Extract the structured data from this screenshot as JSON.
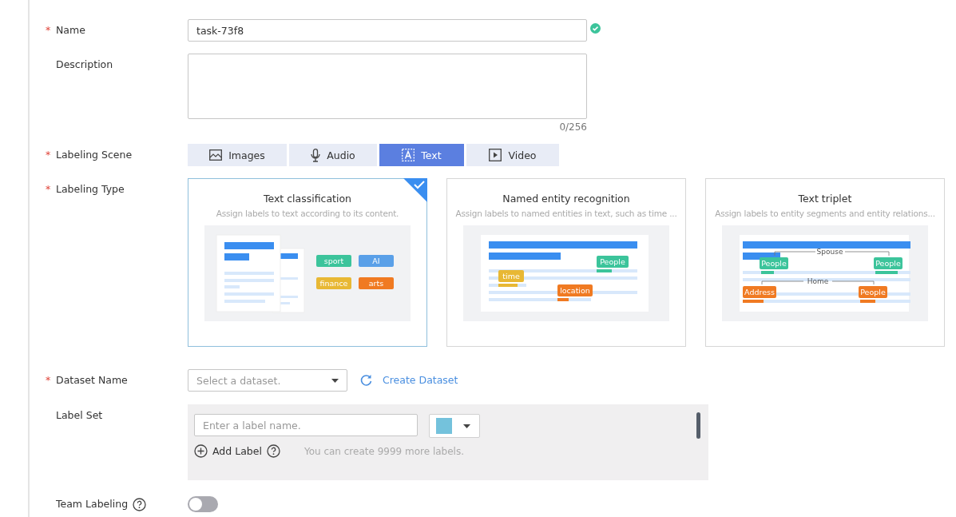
{
  "name_field": {
    "label": "Name",
    "required_mark": "*",
    "value": "task-73f8",
    "valid": true
  },
  "description_field": {
    "label": "Description",
    "counter": "0/256"
  },
  "labeling_scene": {
    "label": "Labeling Scene",
    "required_mark": "*",
    "tabs": [
      {
        "label": "Images",
        "kind": "image",
        "selected": false
      },
      {
        "label": "Audio",
        "kind": "audio",
        "selected": false
      },
      {
        "label": "Text",
        "kind": "text",
        "selected": true
      },
      {
        "label": "Video",
        "kind": "video",
        "selected": false
      }
    ]
  },
  "labeling_type": {
    "label": "Labeling Type",
    "required_mark": "*",
    "cards": [
      {
        "kind": "classification",
        "title": "Text classification",
        "description": "Assign labels to text according to its content.",
        "selected": true,
        "tags": [
          {
            "text": "sport",
            "color": "#3cc49b"
          },
          {
            "text": "AI",
            "color": "#5aa0e8"
          },
          {
            "text": "finance",
            "color": "#e8b834"
          },
          {
            "text": "arts",
            "color": "#f07a22"
          }
        ]
      },
      {
        "kind": "ner",
        "title": "Named entity recognition",
        "description": "Assign labels to named entities in text, such as time ...",
        "selected": false,
        "tags": [
          {
            "text": "People",
            "color": "#3cc49b"
          },
          {
            "text": "time",
            "color": "#e8b834"
          },
          {
            "text": "location",
            "color": "#f07a22"
          }
        ]
      },
      {
        "kind": "triplet",
        "title": "Text triplet",
        "description": "Assign labels to entity segments and entity relations...",
        "selected": false,
        "tags": [
          {
            "text": "People",
            "color": "#3cc49b"
          },
          {
            "text": "People",
            "color": "#3cc49b"
          },
          {
            "text": "Address",
            "color": "#f07a22"
          },
          {
            "text": "People",
            "color": "#f07a22"
          }
        ],
        "relations": [
          "Spouse",
          "Home"
        ]
      }
    ]
  },
  "dataset": {
    "label": "Dataset Name",
    "required_mark": "*",
    "placeholder": "Select a dataset.",
    "create_link": "Create Dataset"
  },
  "label_set": {
    "label": "Label Set",
    "placeholder": "Enter a label name.",
    "color": "#74c2dc",
    "add_label": "Add Label",
    "hint": "You can create 9999 more labels."
  },
  "team_labeling": {
    "label": "Team Labeling",
    "on": false
  }
}
